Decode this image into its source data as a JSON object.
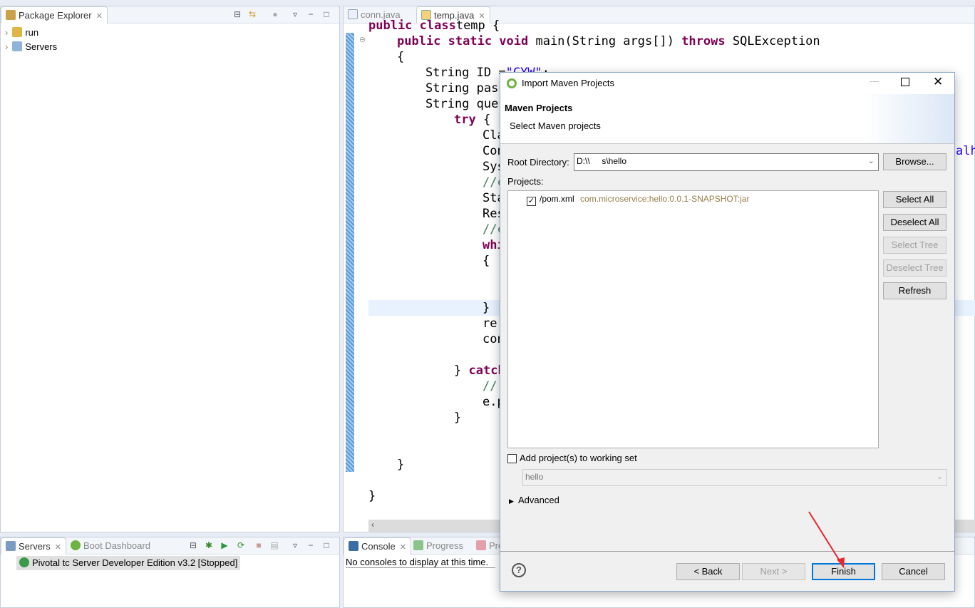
{
  "package_explorer": {
    "tab": "Package Explorer",
    "items": [
      {
        "label": "run"
      },
      {
        "label": "Servers"
      }
    ]
  },
  "editor": {
    "tabs": [
      {
        "label": "conn.java"
      },
      {
        "label": "temp.java"
      }
    ],
    "lines": [
      {
        "indent": 0,
        "parts": [
          [
            "kw",
            "public class"
          ],
          [
            "",
            "temp {"
          ]
        ]
      },
      {
        "indent": 1,
        "parts": [
          [
            "kw",
            "public static void"
          ],
          [
            "",
            " main(String args[]) "
          ],
          [
            "kw",
            "throws"
          ],
          [
            "",
            " SQLException"
          ]
        ]
      },
      {
        "indent": 1,
        "parts": [
          [
            "",
            "{"
          ]
        ]
      },
      {
        "indent": 2,
        "parts": [
          [
            "",
            "String ID ="
          ],
          [
            "str",
            "\"CYW\""
          ],
          [
            "",
            ";"
          ]
        ]
      },
      {
        "indent": 2,
        "parts": [
          [
            "",
            "String pass"
          ]
        ]
      },
      {
        "indent": 2,
        "parts": [
          [
            "",
            "String quer"
          ]
        ]
      },
      {
        "indent": 3,
        "parts": [
          [
            "kw",
            "try"
          ],
          [
            "",
            " {"
          ]
        ]
      },
      {
        "indent": 4,
        "parts": [
          [
            "",
            "Cla"
          ]
        ]
      },
      {
        "indent": 4,
        "parts": [
          [
            "",
            "Con"
          ]
        ]
      },
      {
        "indent": 4,
        "parts": [
          [
            "",
            "Sys"
          ]
        ]
      },
      {
        "indent": 4,
        "parts": [
          [
            "cm",
            "//c"
          ]
        ]
      },
      {
        "indent": 4,
        "parts": [
          [
            "",
            "Sta"
          ]
        ]
      },
      {
        "indent": 4,
        "parts": [
          [
            "",
            "Res"
          ]
        ]
      },
      {
        "indent": 4,
        "parts": [
          [
            "cm",
            "//c"
          ]
        ]
      },
      {
        "indent": 4,
        "parts": [
          [
            "kw",
            "whi"
          ]
        ]
      },
      {
        "indent": 4,
        "parts": [
          [
            "",
            "{"
          ]
        ]
      },
      {
        "indent": 0,
        "parts": []
      },
      {
        "indent": 0,
        "parts": []
      },
      {
        "indent": 4,
        "parts": [
          [
            "",
            "}"
          ]
        ]
      },
      {
        "indent": 4,
        "parts": [
          [
            "",
            "re."
          ]
        ]
      },
      {
        "indent": 4,
        "parts": [
          [
            "",
            "con"
          ]
        ]
      },
      {
        "indent": 0,
        "parts": []
      },
      {
        "indent": 3,
        "parts": [
          [
            "",
            "} "
          ],
          [
            "kw",
            "catch"
          ]
        ]
      },
      {
        "indent": 4,
        "parts": [
          [
            "cm",
            "//"
          ]
        ]
      },
      {
        "indent": 4,
        "parts": [
          [
            "",
            "e.p"
          ]
        ]
      },
      {
        "indent": 3,
        "parts": [
          [
            "",
            "}"
          ]
        ]
      },
      {
        "indent": 0,
        "parts": []
      },
      {
        "indent": 0,
        "parts": []
      },
      {
        "indent": 1,
        "parts": [
          [
            "",
            "}"
          ]
        ]
      },
      {
        "indent": 0,
        "parts": []
      },
      {
        "indent": 0,
        "parts": [
          [
            "",
            "}"
          ]
        ]
      }
    ],
    "overflow_fragment": "alho"
  },
  "servers": {
    "tabs": [
      {
        "label": "Servers"
      },
      {
        "label": "Boot Dashboard"
      }
    ],
    "items": [
      {
        "label": "Pivotal tc Server Developer Edition v3.2  [Stopped]"
      }
    ]
  },
  "console": {
    "tabs": [
      {
        "label": "Console"
      },
      {
        "label": "Progress"
      },
      {
        "label": "Pro"
      }
    ],
    "message": "No consoles to display at this time."
  },
  "dialog": {
    "title": "Import Maven Projects",
    "header_title": "Maven Projects",
    "header_desc": "Select Maven projects",
    "root_label": "Root Directory:",
    "root_value": "D:\\\\     s\\hello",
    "browse": "Browse...",
    "projects_label": "Projects:",
    "projects": [
      {
        "checked": true,
        "name": "/pom.xml",
        "artifact": "com.microservice:hello:0.0.1-SNAPSHOT:jar"
      }
    ],
    "side_buttons": [
      {
        "label": "Select All",
        "enabled": true
      },
      {
        "label": "Deselect All",
        "enabled": true
      },
      {
        "label": "Select Tree",
        "enabled": false
      },
      {
        "label": "Deselect Tree",
        "enabled": false
      },
      {
        "label": "Refresh",
        "enabled": true
      }
    ],
    "working_set_label": "Add project(s) to working set",
    "working_set_checked": false,
    "working_set_value": "hello",
    "advanced": "Advanced",
    "back": "< Back",
    "next": "Next >",
    "finish": "Finish",
    "cancel": "Cancel"
  },
  "colors": {
    "keyword": "#7f0055",
    "string": "#2a00ff",
    "comment": "#3f7f5f",
    "default_button": "#0078d7",
    "annotation_arrow": "#e8262b"
  }
}
